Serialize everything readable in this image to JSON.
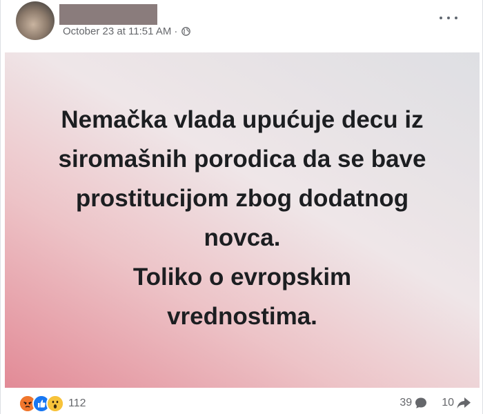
{
  "post": {
    "timestamp": "October 23 at 11:51 AM",
    "separator": "·",
    "audience_icon": "globe-icon",
    "more_icon": "more-options-icon"
  },
  "card": {
    "background_colors": [
      "#e28a96",
      "#efe6e8",
      "#dedfe3"
    ],
    "lines": [
      "Nemačka vlada upućuje decu iz",
      "siromašnih porodica da se bave",
      "prostitucijom zbog dodatnog",
      "novca.",
      "Toliko o evropskim",
      "vrednostima."
    ]
  },
  "footer": {
    "reaction_icons": [
      "angry-icon",
      "like-icon",
      "wow-icon"
    ],
    "reaction_count": "112",
    "comments_count": "39",
    "shares_count": "10",
    "comment_icon": "comment-icon",
    "share_icon": "share-icon"
  }
}
